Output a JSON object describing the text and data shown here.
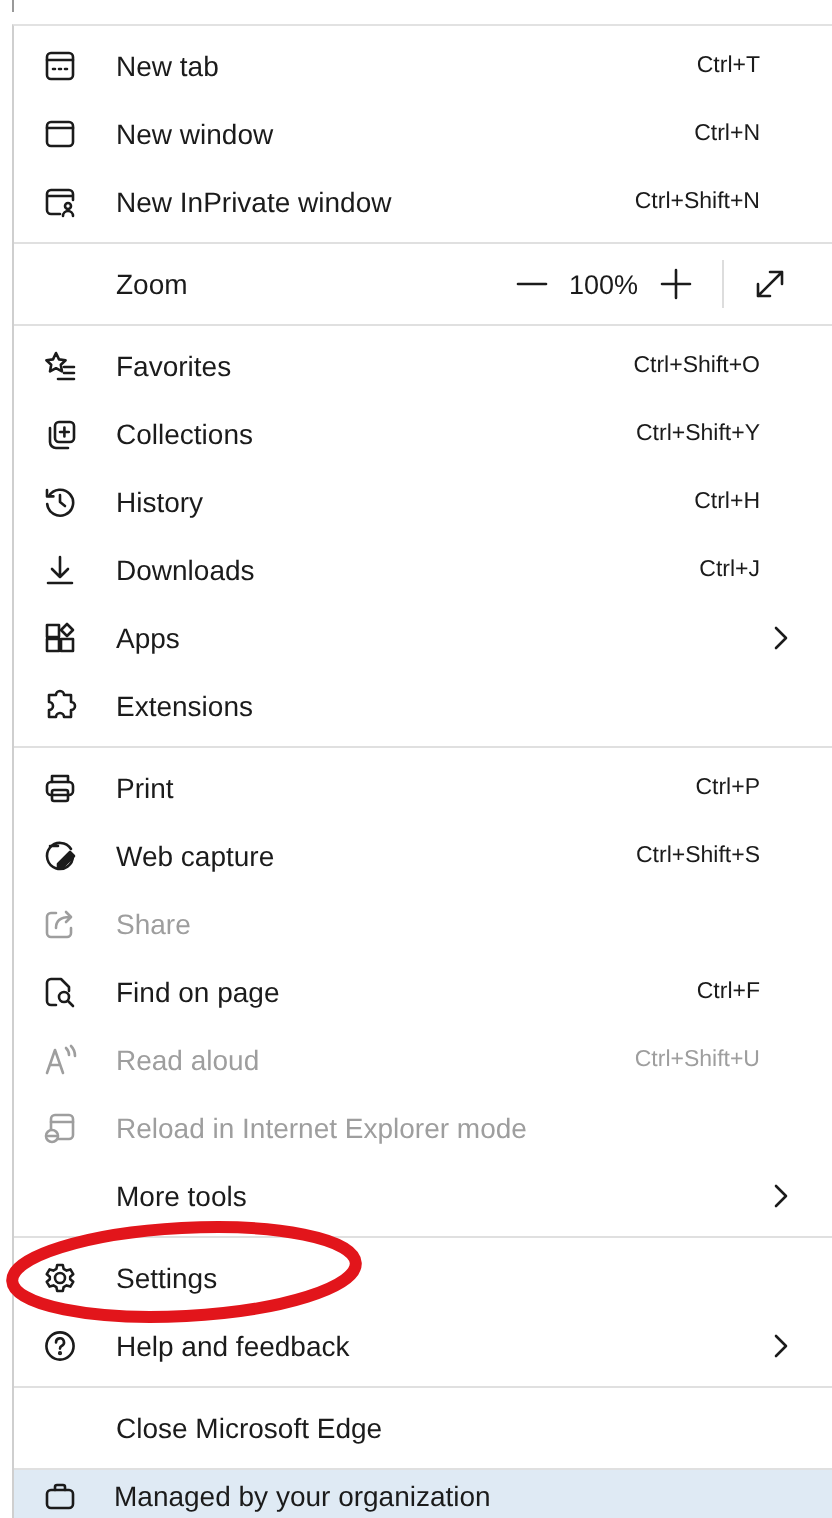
{
  "sections": [
    {
      "items": [
        {
          "kind": "item",
          "label": "New tab",
          "shortcut": "Ctrl+T",
          "disabled": false,
          "submenu": false
        },
        {
          "kind": "item",
          "label": "New window",
          "shortcut": "Ctrl+N",
          "disabled": false,
          "submenu": false
        },
        {
          "kind": "item",
          "label": "New InPrivate window",
          "shortcut": "Ctrl+Shift+N",
          "disabled": false,
          "submenu": false
        }
      ]
    },
    {
      "items": [
        {
          "kind": "zoom",
          "label": "Zoom",
          "value": "100%"
        }
      ]
    },
    {
      "items": [
        {
          "kind": "item",
          "label": "Favorites",
          "shortcut": "Ctrl+Shift+O",
          "disabled": false,
          "submenu": false
        },
        {
          "kind": "item",
          "label": "Collections",
          "shortcut": "Ctrl+Shift+Y",
          "disabled": false,
          "submenu": false
        },
        {
          "kind": "item",
          "label": "History",
          "shortcut": "Ctrl+H",
          "disabled": false,
          "submenu": false
        },
        {
          "kind": "item",
          "label": "Downloads",
          "shortcut": "Ctrl+J",
          "disabled": false,
          "submenu": false
        },
        {
          "kind": "item",
          "label": "Apps",
          "disabled": false,
          "submenu": true
        },
        {
          "kind": "item",
          "label": "Extensions",
          "disabled": false,
          "submenu": false
        }
      ]
    },
    {
      "items": [
        {
          "kind": "item",
          "label": "Print",
          "shortcut": "Ctrl+P",
          "disabled": false,
          "submenu": false
        },
        {
          "kind": "item",
          "label": "Web capture",
          "shortcut": "Ctrl+Shift+S",
          "disabled": false,
          "submenu": false
        },
        {
          "kind": "item",
          "label": "Share",
          "disabled": true,
          "submenu": false
        },
        {
          "kind": "item",
          "label": "Find on page",
          "shortcut": "Ctrl+F",
          "disabled": false,
          "submenu": false
        },
        {
          "kind": "item",
          "label": "Read aloud",
          "shortcut": "Ctrl+Shift+U",
          "disabled": true,
          "submenu": false
        },
        {
          "kind": "item",
          "label": "Reload in Internet Explorer mode",
          "disabled": true,
          "submenu": false
        },
        {
          "kind": "item",
          "label": "More tools",
          "disabled": false,
          "submenu": true
        }
      ]
    },
    {
      "items": [
        {
          "kind": "item",
          "label": "Settings",
          "disabled": false,
          "submenu": false
        },
        {
          "kind": "item",
          "label": "Help and feedback",
          "disabled": false,
          "submenu": true
        }
      ]
    },
    {
      "items": [
        {
          "kind": "item",
          "label": "Close Microsoft Edge",
          "disabled": false,
          "submenu": false
        }
      ]
    }
  ],
  "footer": {
    "label": "Managed by your organization"
  },
  "annotation": {
    "kind": "ellipse"
  }
}
